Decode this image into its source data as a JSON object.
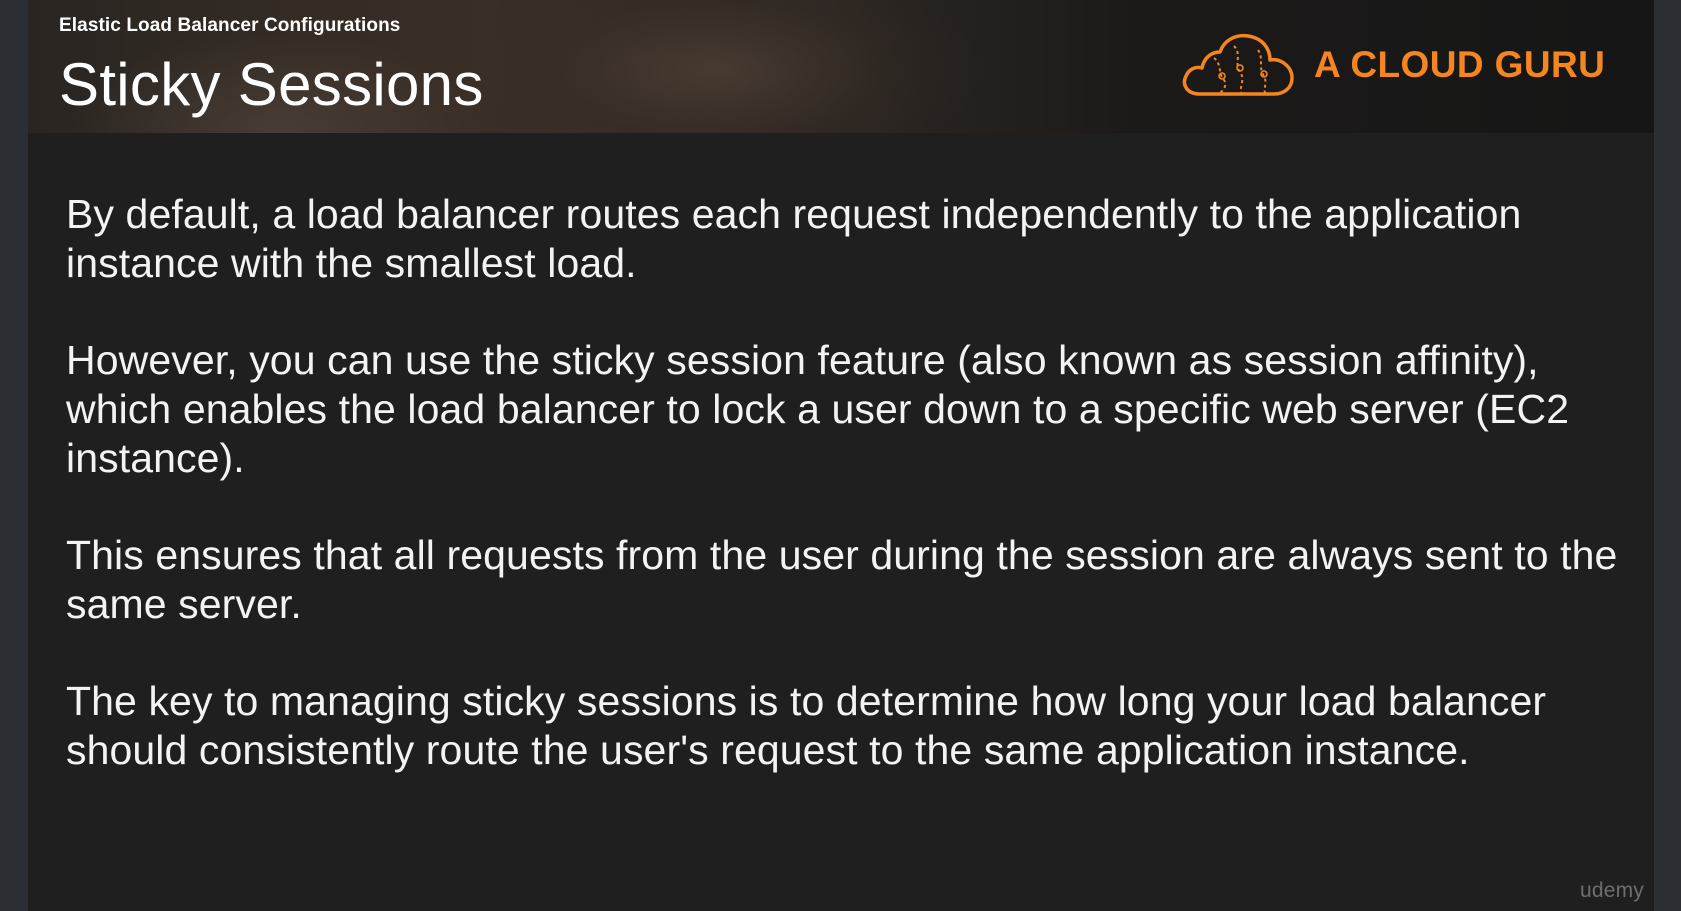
{
  "slide": {
    "kicker": "Elastic Load Balancer Configurations",
    "title": "Sticky Sessions",
    "brand": {
      "name": "A CLOUD GURU",
      "color": "#f58520",
      "icon": "cloud-logo-icon"
    },
    "paragraphs": [
      "By default, a load balancer routes each request independently to the application instance with the smallest load.",
      "However, you can use the sticky session feature (also known as session affinity), which enables the load balancer to lock a user down to a specific web server (EC2 instance).",
      "This ensures that all requests from the user during the session are always sent to the same server.",
      "The key to managing sticky sessions is to determine how long your load balancer should consistently route the user's request to the same application instance."
    ],
    "watermark": "udemy"
  }
}
